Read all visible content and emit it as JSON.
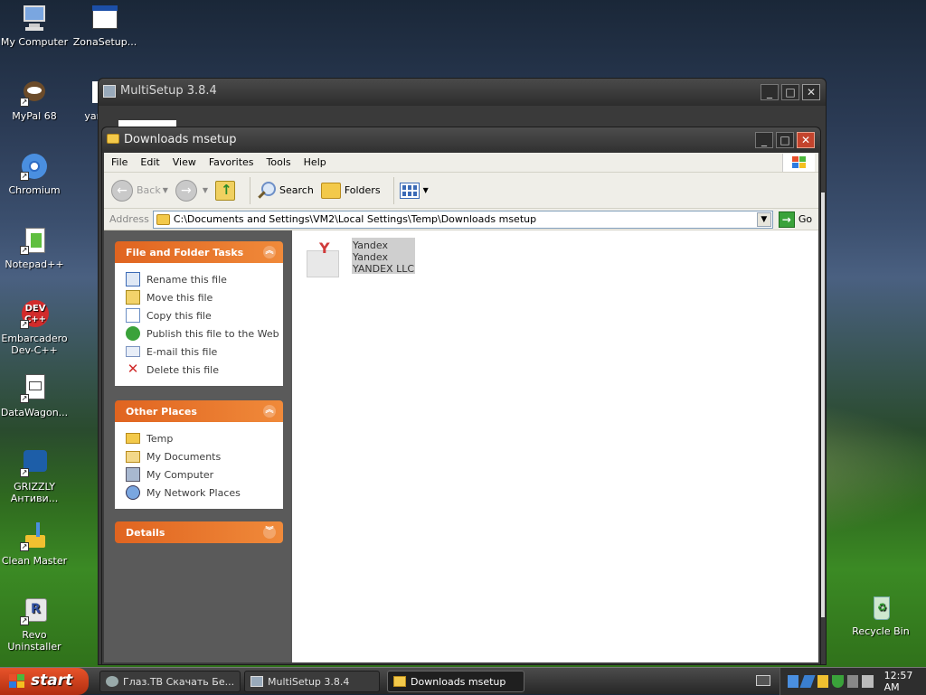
{
  "desktop": {
    "icons": [
      {
        "label": "My Computer"
      },
      {
        "label": "ZonaSetup..."
      },
      {
        "label": "MyPal 68"
      },
      {
        "label": "yand"
      },
      {
        "label": "Chromium"
      },
      {
        "label": "Notepad++"
      },
      {
        "label": "Embarcadero Dev-C++"
      },
      {
        "label": "DataWagon..."
      },
      {
        "label": "GRIZZLY Антиви..."
      },
      {
        "label": "Clean Master"
      },
      {
        "label": "Revo Uninstaller"
      },
      {
        "label": "Recycle Bin"
      }
    ]
  },
  "multisetup": {
    "title": "MultiSetup 3.8.4"
  },
  "explorer": {
    "title": "Downloads msetup",
    "menu": [
      "File",
      "Edit",
      "View",
      "Favorites",
      "Tools",
      "Help"
    ],
    "toolbar": {
      "back": "Back",
      "search": "Search",
      "folders": "Folders"
    },
    "address": {
      "label": "Address",
      "value": "C:\\Documents and Settings\\VM2\\Local Settings\\Temp\\Downloads msetup",
      "go": "Go"
    },
    "file_tasks": {
      "header": "File and Folder Tasks",
      "items": [
        "Rename this file",
        "Move this file",
        "Copy this file",
        "Publish this file to the Web",
        "E-mail this file",
        "Delete this file"
      ]
    },
    "other_places": {
      "header": "Other Places",
      "items": [
        "Temp",
        "My Documents",
        "My Computer",
        "My Network Places"
      ]
    },
    "details": {
      "header": "Details"
    },
    "files": [
      {
        "line1": "Yandex",
        "line2": "Yandex",
        "line3": "YANDEX LLC"
      }
    ]
  },
  "taskbar": {
    "start": "start",
    "buttons": [
      "Глаз.ТВ Скачать Бе...",
      "MultiSetup 3.8.4",
      "Downloads msetup"
    ],
    "clock": "12:57 AM"
  }
}
